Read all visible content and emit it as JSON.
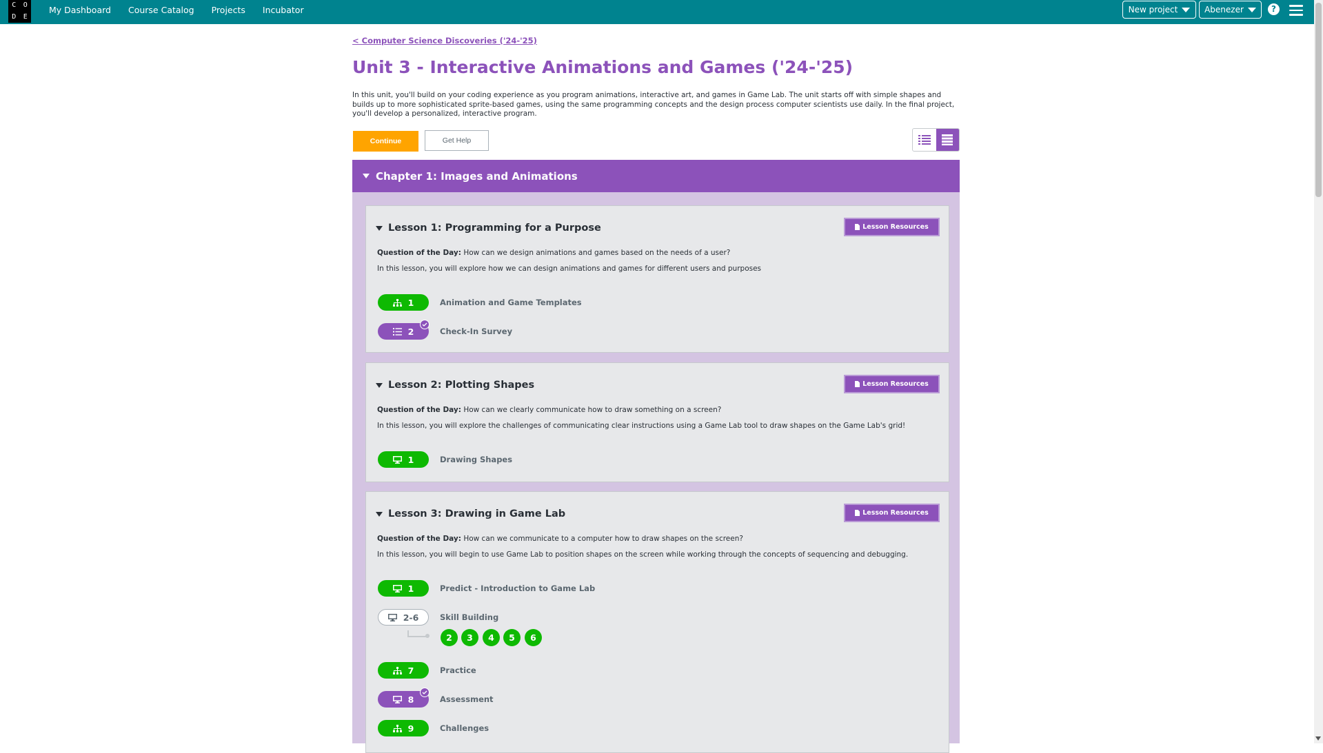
{
  "header": {
    "logo_letters": [
      "C",
      "O",
      "D",
      "E"
    ],
    "nav": [
      "My Dashboard",
      "Course Catalog",
      "Projects",
      "Incubator"
    ],
    "new_project_label": "New project",
    "user_label": "Abenezer",
    "help_glyph": "?",
    "brand_color": "#00838f"
  },
  "breadcrumb": "< Computer Science Discoveries ('24-'25)",
  "unit": {
    "title": "Unit 3 - Interactive Animations and Games ('24-'25)",
    "description": "In this unit, you'll build on your coding experience as you program animations, interactive art, and games in Game Lab. The unit starts off with simple shapes and builds up to more sophisticated sprite-based games, using the same programming concepts and the design process computer scientists use daily. In the final project, you'll develop a personalized, interactive program.",
    "continue_label": "Continue",
    "help_label": "Get Help",
    "accent_color": "#8c52ba",
    "view_modes": [
      "list-view-icon",
      "detail-view-icon"
    ]
  },
  "chapter": {
    "title": "Chapter 1: Images and Animations",
    "lessons": [
      {
        "title": "Lesson 1: Programming for a Purpose",
        "resources_label": "Lesson Resources",
        "qotd_label": "Question of the Day:",
        "qotd": "How can we design animations and games based on the needs of a user?",
        "description": "In this lesson, you will explore how we can design animations and games for different users and purposes",
        "levels": [
          {
            "icon": "sitemap-icon",
            "number": "1",
            "name": "Animation and Game Templates",
            "style": "green"
          },
          {
            "icon": "list-icon",
            "number": "2",
            "name": "Check-In Survey",
            "style": "purple",
            "checked": true
          }
        ]
      },
      {
        "title": "Lesson 2: Plotting Shapes",
        "resources_label": "Lesson Resources",
        "qotd_label": "Question of the Day:",
        "qotd": "How can we clearly communicate how to draw something on a screen?",
        "description": "In this lesson, you will explore the challenges of communicating clear instructions using a Game Lab tool to draw shapes on the Game Lab's grid!",
        "levels": [
          {
            "icon": "desktop-icon",
            "number": "1",
            "name": "Drawing Shapes",
            "style": "green"
          }
        ]
      },
      {
        "title": "Lesson 3: Drawing in Game Lab",
        "resources_label": "Lesson Resources",
        "qotd_label": "Question of the Day:",
        "qotd": "How can we communicate to a computer how to draw shapes on the screen?",
        "description": "In this lesson, you will begin to use Game Lab to position shapes on the screen while working through the concepts of sequencing and debugging.",
        "levels": [
          {
            "icon": "desktop-icon",
            "number": "1",
            "name": "Predict - Introduction to Game Lab",
            "style": "green"
          },
          {
            "icon": "desktop-icon",
            "number": "2-6",
            "name": "Skill Building",
            "style": "outline",
            "sublevels": [
              "2",
              "3",
              "4",
              "5",
              "6"
            ]
          },
          {
            "icon": "sitemap-icon",
            "number": "7",
            "name": "Practice",
            "style": "green"
          },
          {
            "icon": "desktop-icon",
            "number": "8",
            "name": "Assessment",
            "style": "purple",
            "checked": true
          },
          {
            "icon": "sitemap-icon",
            "number": "9",
            "name": "Challenges",
            "style": "green"
          }
        ]
      }
    ]
  }
}
